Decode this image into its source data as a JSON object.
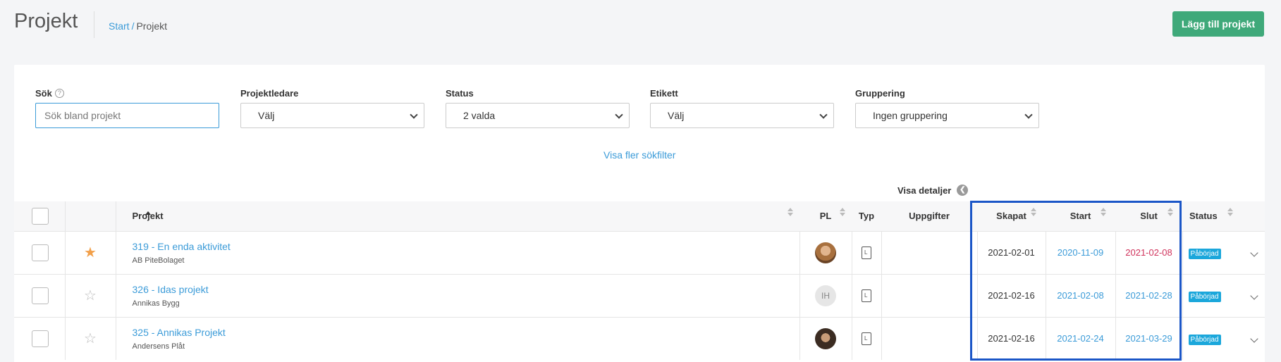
{
  "header": {
    "title": "Projekt",
    "breadcrumb": {
      "home": "Start",
      "separator": "/",
      "current": "Projekt"
    },
    "add_button": "Lägg till projekt"
  },
  "filters": {
    "search": {
      "label": "Sök",
      "placeholder": "Sök bland projekt"
    },
    "project_manager": {
      "label": "Projektledare",
      "value": "Välj"
    },
    "status": {
      "label": "Status",
      "value": "2 valda"
    },
    "tag": {
      "label": "Etikett",
      "value": "Välj"
    },
    "grouping": {
      "label": "Gruppering",
      "value": "Ingen gruppering"
    },
    "more_filters": "Visa fler sökfilter"
  },
  "details_toggle": "Visa detaljer",
  "table": {
    "columns": {
      "project": "Projekt",
      "pl": "PL",
      "type": "Typ",
      "expenses": "Uppgifter",
      "created": "Skapat",
      "start": "Start",
      "end": "Slut",
      "status": "Status"
    },
    "rows": [
      {
        "name": "319 - En enda aktivitet",
        "client": "AB PiteBolaget",
        "starred": true,
        "pl": "",
        "created": "2021-02-01",
        "start": "2020-11-09",
        "end": "2021-02-08",
        "status": "Påbörjad"
      },
      {
        "name": "326 - Idas projekt",
        "client": "Annikas Bygg",
        "starred": false,
        "pl": "IH",
        "created": "2021-02-16",
        "start": "2021-02-08",
        "end": "2021-02-28",
        "status": "Påbörjad"
      },
      {
        "name": "325 - Annikas Projekt",
        "client": "Andersens Plåt",
        "starred": false,
        "pl": "",
        "created": "2021-02-16",
        "start": "2021-02-24",
        "end": "2021-03-29",
        "status": "Påbörjad"
      }
    ]
  },
  "colors": {
    "accent": "#3b9bd8",
    "primary_button": "#3fa97a",
    "highlight": "#1b56c7",
    "badge": "#1ba7db",
    "overdue": "#d0335c",
    "star": "#f2a04a"
  }
}
